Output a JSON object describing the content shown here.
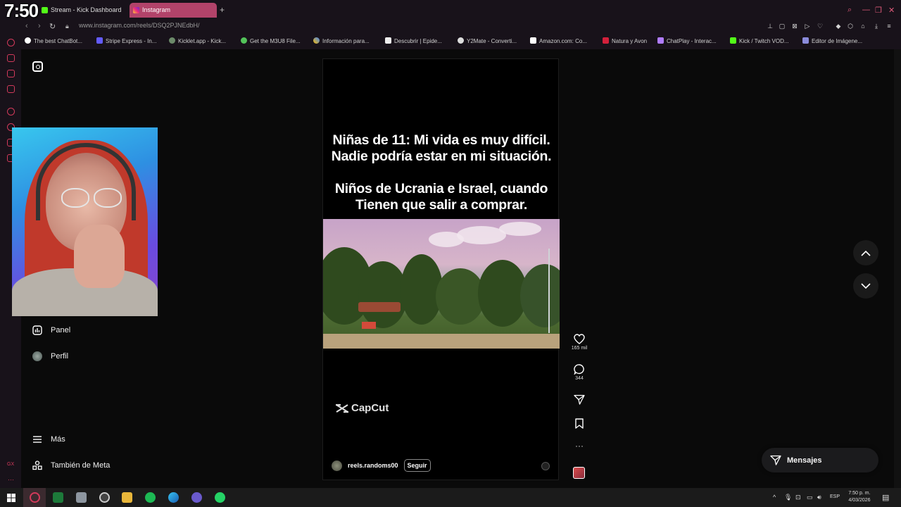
{
  "overlay": {
    "clock": "7:50"
  },
  "tabs": [
    {
      "label": "Stream - Kick Dashboard",
      "active": false
    },
    {
      "label": "Instagram",
      "active": true
    }
  ],
  "address": {
    "url": "www.instagram.com/reels/DSQ2PJNEdbH/"
  },
  "bookmarks": [
    "The best ChatBot...",
    "Stripe Express - In...",
    "Kicklet.app - Kick...",
    "Get the M3U8 File...",
    "Información para...",
    "Descubrir | Epide...",
    "Y2Mate - Converti...",
    "Amazon.com: Co...",
    "Natura y Avon",
    "ChatPlay - Interac...",
    "Kick / Twitch VOD...",
    "Editor de Imágene..."
  ],
  "sidebar": {
    "panel": "Panel",
    "profile": "Perfil",
    "more": "Más",
    "meta": "También de Meta"
  },
  "reel": {
    "caption_line1": "Niñas de 11: Mi vida es muy difícil.",
    "caption_line2": "Nadie podría estar en mi situación.",
    "caption_line3": "Niños de Ucrania e Israel, cuando",
    "caption_line4": "Tienen que salir a comprar.",
    "watermark": "CapCut",
    "author": "reels.randoms00",
    "follow": "Seguir"
  },
  "actions": {
    "likes": "165 mil",
    "comments": "344"
  },
  "messages": {
    "label": "Mensajes"
  },
  "taskbar": {
    "lang": "ESP",
    "time": "7:50 p. m.",
    "date": "4/03/2026"
  },
  "colors": {
    "accent": "#d33a5b",
    "active_tab": "#b2436a",
    "background": "#0a0a0a"
  }
}
